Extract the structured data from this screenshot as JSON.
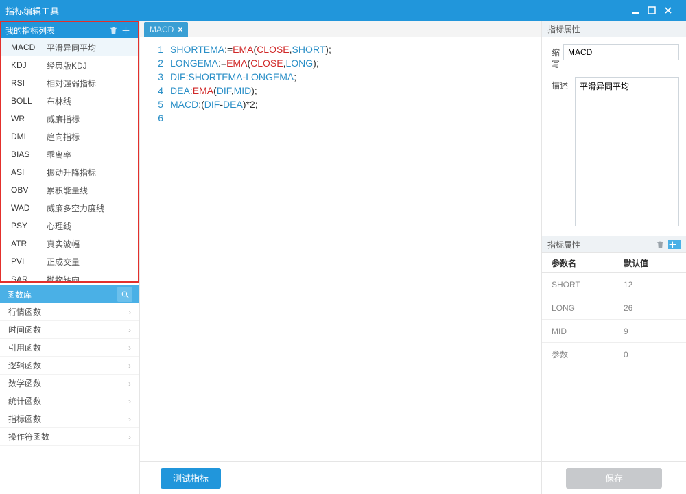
{
  "window": {
    "title": "指标编辑工具"
  },
  "sidebar": {
    "indicator_header": "我的指标列表",
    "indicators": [
      {
        "code": "MACD",
        "name": "平滑异同平均",
        "selected": true
      },
      {
        "code": "KDJ",
        "name": "经典版KDJ"
      },
      {
        "code": "RSI",
        "name": "相对强弱指标"
      },
      {
        "code": "BOLL",
        "name": "布林线"
      },
      {
        "code": "WR",
        "name": "威廉指标"
      },
      {
        "code": "DMI",
        "name": "趋向指标"
      },
      {
        "code": "BIAS",
        "name": "乖离率"
      },
      {
        "code": "ASI",
        "name": "振动升降指标"
      },
      {
        "code": "OBV",
        "name": "累积能量线"
      },
      {
        "code": "WAD",
        "name": "威廉多空力度线"
      },
      {
        "code": "PSY",
        "name": "心理线"
      },
      {
        "code": "ATR",
        "name": "真实波幅"
      },
      {
        "code": "PVI",
        "name": "正成交量"
      },
      {
        "code": "SAR",
        "name": "抛物转向"
      }
    ],
    "func_header": "函数库",
    "func_categories": [
      "行情函数",
      "时间函数",
      "引用函数",
      "逻辑函数",
      "数学函数",
      "统计函数",
      "指标函数",
      "操作符函数"
    ]
  },
  "editor": {
    "tab_label": "MACD",
    "lines": [
      [
        [
          "kw",
          "SHORTEMA"
        ],
        [
          "op",
          ":="
        ],
        [
          "fn",
          "EMA"
        ],
        [
          "op",
          "("
        ],
        [
          "fn",
          "CLOSE"
        ],
        [
          "op",
          ","
        ],
        [
          "kw",
          "SHORT"
        ],
        [
          "op",
          ");"
        ]
      ],
      [
        [
          "kw",
          "LONGEMA"
        ],
        [
          "op",
          ":="
        ],
        [
          "fn",
          "EMA"
        ],
        [
          "op",
          "("
        ],
        [
          "fn",
          "CLOSE"
        ],
        [
          "op",
          ","
        ],
        [
          "kw",
          "LONG"
        ],
        [
          "op",
          ");"
        ]
      ],
      [
        [
          "kw",
          "DIF"
        ],
        [
          "op",
          ":"
        ],
        [
          "kw",
          "SHORTEMA"
        ],
        [
          "op",
          "-"
        ],
        [
          "kw",
          "LONGEMA"
        ],
        [
          "op",
          ";"
        ]
      ],
      [
        [
          "kw",
          "DEA"
        ],
        [
          "op",
          ":"
        ],
        [
          "fn",
          "EMA"
        ],
        [
          "op",
          "("
        ],
        [
          "kw",
          "DIF"
        ],
        [
          "op",
          ","
        ],
        [
          "kw",
          "MID"
        ],
        [
          "op",
          ");"
        ]
      ],
      [
        [
          "kw",
          "MACD"
        ],
        [
          "op",
          ":("
        ],
        [
          "kw",
          "DIF"
        ],
        [
          "op",
          "-"
        ],
        [
          "kw",
          "DEA"
        ],
        [
          "op",
          ")*"
        ],
        [
          "arg",
          "2"
        ],
        [
          "op",
          ";"
        ]
      ],
      []
    ],
    "test_btn": "测试指标"
  },
  "props": {
    "header": "指标属性",
    "abbr_label": "缩写",
    "abbr_value": "MACD",
    "desc_label": "描述",
    "desc_value": "平滑异同平均",
    "params_header": "指标属性",
    "param_col_name": "参数名",
    "param_col_default": "默认值",
    "params": [
      {
        "name": "SHORT",
        "default": "12"
      },
      {
        "name": "LONG",
        "default": "26"
      },
      {
        "name": "MID",
        "default": "9"
      },
      {
        "name": "参数",
        "default": "0"
      }
    ],
    "save_btn": "保存"
  }
}
